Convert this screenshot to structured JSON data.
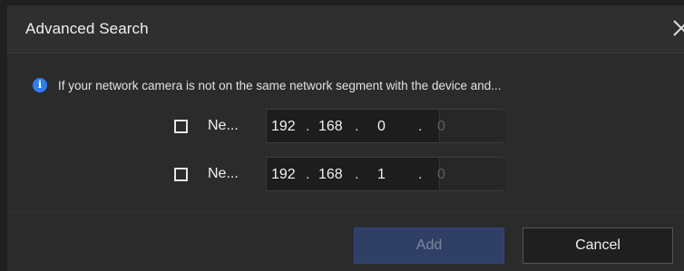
{
  "dialog": {
    "title": "Advanced Search",
    "close_icon": "close-icon"
  },
  "info": {
    "icon": "info-icon",
    "icon_glyph": "i",
    "text": "If your network camera is not on the same network segment with the device and..."
  },
  "segments": [
    {
      "label": "Ne...",
      "checked": false,
      "ip": [
        "192",
        "168",
        "0",
        "0"
      ],
      "dots": [
        ".",
        ".",
        "."
      ]
    },
    {
      "label": "Ne...",
      "checked": false,
      "ip": [
        "192",
        "168",
        "1",
        "0"
      ],
      "dots": [
        ".",
        ".",
        "."
      ]
    }
  ],
  "footer": {
    "add_label": "Add",
    "cancel_label": "Cancel"
  },
  "colors": {
    "background": "#2b2b2b",
    "accent": "#2f7ef0",
    "add_button": "#2f3f66"
  }
}
